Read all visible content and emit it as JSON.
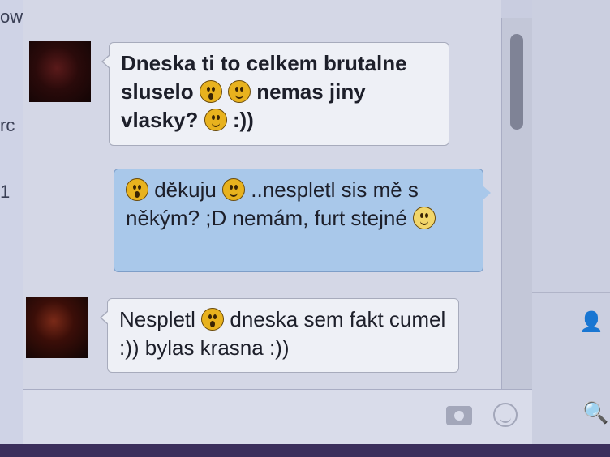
{
  "left_strip": {
    "frags": [
      "ow",
      "rc",
      "1"
    ]
  },
  "messages": [
    {
      "sender": "other",
      "parts": [
        {
          "t": "Dneska ti to celkem brutalne sluselo "
        },
        {
          "e": "gasp"
        },
        {
          "t": " "
        },
        {
          "e": "smile"
        },
        {
          "t": " nemas jiny vlasky? "
        },
        {
          "e": "smile"
        },
        {
          "t": " :))"
        }
      ]
    },
    {
      "sender": "me",
      "parts": [
        {
          "e": "gasp"
        },
        {
          "t": " děkuju "
        },
        {
          "e": "smile"
        },
        {
          "t": " ..nespletl sis mě s někým? ;D nemám, furt stejné "
        },
        {
          "e": "wink"
        }
      ]
    },
    {
      "sender": "other",
      "parts": [
        {
          "t": "Nespletl "
        },
        {
          "e": "gasp"
        },
        {
          "t": " dneska sem fakt cumel :)) bylas krasna :))"
        }
      ]
    }
  ],
  "icons": {
    "friends": "friends-icon",
    "search": "search-icon",
    "camera": "camera-icon",
    "emoji": "smiley-icon"
  },
  "colors": {
    "outgoing_bubble": "#a9c8ea",
    "incoming_bubble": "#eef0f6",
    "emoji": "#e8b21e"
  }
}
